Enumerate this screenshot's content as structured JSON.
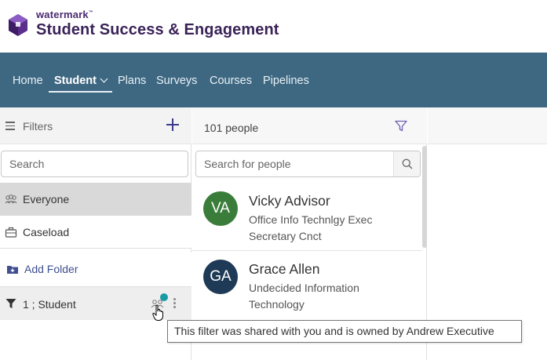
{
  "brand": {
    "small": "watermark",
    "trademark": "™",
    "title": "Student Success & Engagement"
  },
  "nav": {
    "items": [
      {
        "label": "Home"
      },
      {
        "label": "Student"
      },
      {
        "label": "Plans"
      },
      {
        "label": "Surveys"
      },
      {
        "label": "Courses"
      },
      {
        "label": "Pipelines"
      }
    ],
    "active": "Student"
  },
  "sidebar": {
    "header": "Filters",
    "search_placeholder": "Search",
    "items": [
      {
        "label": "Everyone",
        "icon": "group-icon",
        "selected": true
      },
      {
        "label": "Caseload",
        "icon": "briefcase-icon"
      },
      {
        "label": "Add Folder",
        "icon": "add-folder-icon"
      },
      {
        "label": "1 ; Student",
        "icon": "filter-icon"
      }
    ]
  },
  "people": {
    "count": "101 people",
    "search_placeholder": "Search for people",
    "list": [
      {
        "initials": "VA",
        "name": "Vicky Advisor",
        "description": "Office Info Technlgy Exec Secretary Cnct",
        "color": "#3a7d3a"
      },
      {
        "initials": "GA",
        "name": "Grace Allen",
        "description": "Undecided Information Technology",
        "color": "#1f3a56"
      }
    ]
  },
  "tooltip": {
    "text": "This filter was shared with you and is owned by Andrew Executive"
  },
  "colors": {
    "navbar": "#3e6882",
    "brand": "#3a2358",
    "shared_dot": "#1a9aa3",
    "add_folder": "#3f4f8f"
  }
}
